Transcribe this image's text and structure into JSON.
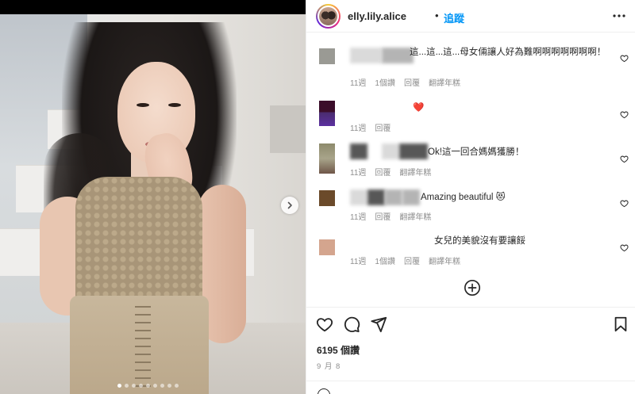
{
  "post": {
    "username": "elly.lily.alice",
    "separator": "•",
    "follow_label": "追蹤",
    "views": "6195 個讚",
    "date": "9 月 8"
  },
  "carousel": {
    "slide_count": 9,
    "active_index": 0
  },
  "comments": [
    {
      "text": "這...這...這...母女倆讓人好為難啊啊啊啊啊啊啊！",
      "time": "11週",
      "likes": "1個讚",
      "reply": "回覆",
      "translate": "翻譯年糕",
      "avatar_color": "#9a9a94"
    },
    {
      "text": "❤️",
      "time": "11週",
      "likes": "",
      "reply": "回覆",
      "translate": "",
      "avatar_color": "#4a2c6e"
    },
    {
      "text": "Ok!這一回合媽媽獲勝！",
      "time": "11週",
      "likes": "",
      "reply": "回覆",
      "translate": "翻譯年糕",
      "avatar_color": "#8d8a6c"
    },
    {
      "text": "Amazing beautiful 😻",
      "time": "11週",
      "likes": "",
      "reply": "回覆",
      "translate": "翻譯年糕",
      "avatar_color": "#6b4a2a"
    },
    {
      "text": "女兒的美貌沒有要讓餒",
      "time": "11週",
      "likes": "1個讚",
      "reply": "回覆",
      "translate": "翻譯年糕",
      "avatar_color": "#d4a58e"
    }
  ],
  "icons": {
    "next": "chevron-right-icon",
    "more": "more-horizontal-icon",
    "heart": "heart-outline-icon",
    "load_more": "plus-circle-icon",
    "like": "heart-outline-icon",
    "comment": "comment-icon",
    "share": "send-icon",
    "save": "bookmark-icon"
  }
}
